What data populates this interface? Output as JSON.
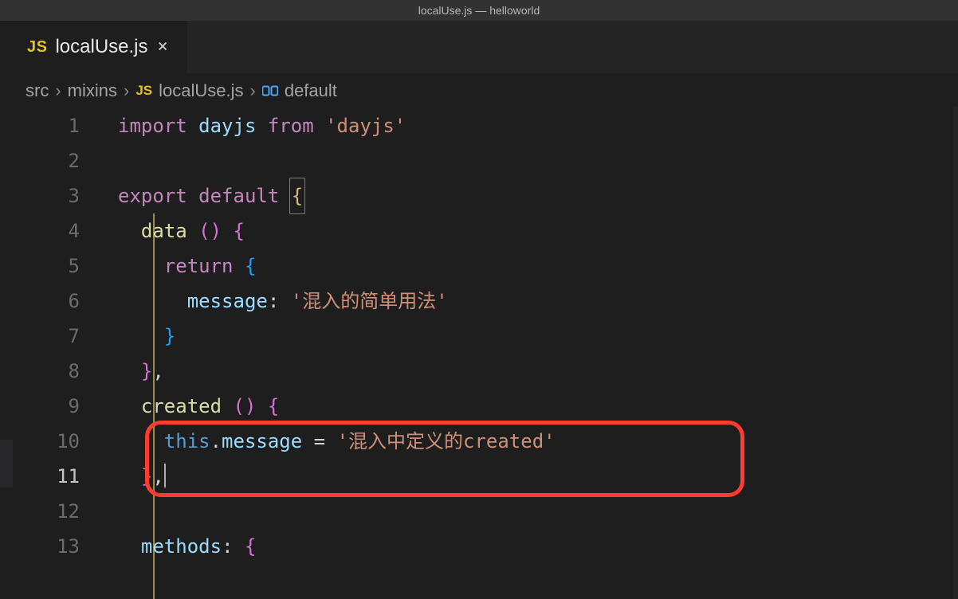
{
  "window_title": "localUse.js — helloworld",
  "tab": {
    "icon_label": "JS",
    "name": "localUse.js",
    "close_glyph": "×"
  },
  "breadcrumbs": {
    "items": [
      "src",
      "mixins",
      "localUse.js",
      "default"
    ],
    "js_icon_label": "JS",
    "sep": "›"
  },
  "code": {
    "line_numbers": [
      "1",
      "2",
      "3",
      "4",
      "5",
      "6",
      "7",
      "8",
      "9",
      "10",
      "11",
      "12",
      "13"
    ],
    "tokens": {
      "kw_import": "import",
      "kw_from": "from",
      "kw_export": "export",
      "kw_default": "default",
      "kw_return": "return",
      "ident_dayjs": "dayjs",
      "str_dayjs": "'dayjs'",
      "fn_data": "data",
      "fn_created": "created",
      "ident_methods": "methods",
      "ident_message": "message",
      "ident_this": "this",
      "str_message_value": "'混入的简单用法'",
      "str_created_value": "'混入中定义的created'",
      "parens": "()",
      "brace_open": "{",
      "brace_close": "}",
      "comma": ",",
      "colon": ":",
      "eq": "="
    }
  }
}
